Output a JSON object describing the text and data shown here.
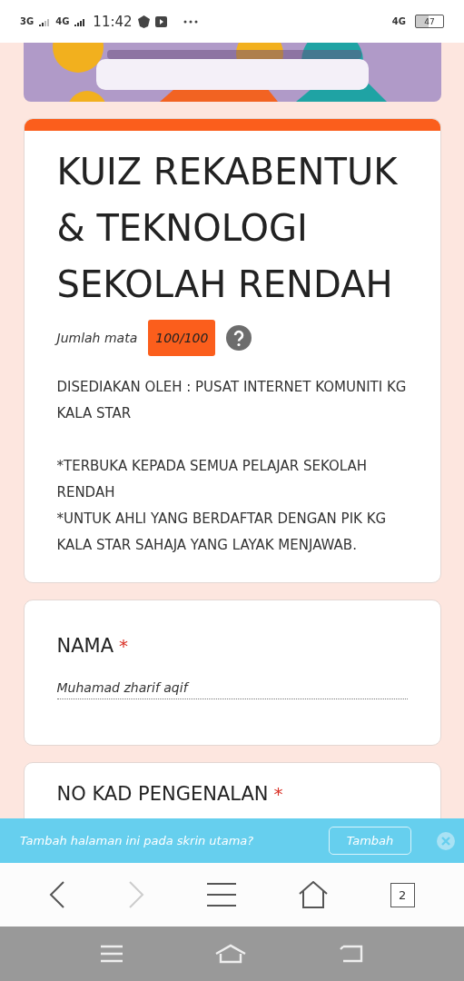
{
  "status_bar": {
    "network_1": "3G",
    "network_2": "4G",
    "time": "11:42",
    "network_right": "4G",
    "battery": "47"
  },
  "intro_card": {
    "title": "KUIZ REKABENTUK & TEKNOLOGI SEKOLAH RENDAH",
    "points_label": "Jumlah mata",
    "points": "100/100",
    "description": [
      [
        "DISEDIAKAN OLEH : PUSAT INTERNET KOMUNITI KG KALA STAR"
      ],
      [
        "*TERBUKA KEPADA SEMUA PELAJAR SEKOLAH RENDAH",
        "*UNTUK AHLI YANG BERDAFTAR DENGAN PIK KG KALA STAR SAHAJA YANG LAYAK MENJAWAB."
      ]
    ]
  },
  "questions": [
    {
      "label": "NAMA",
      "required": true,
      "required_mark": "*",
      "value": "Muhamad zharif aqif"
    },
    {
      "label": "NO KAD PENGENALAN",
      "required": true,
      "required_mark": "*"
    }
  ],
  "add_to_home_banner": {
    "message": "Tambah halaman ini pada skrin utama?",
    "button": "Tambah"
  },
  "browser_toolbar": {
    "back_disabled": false,
    "forward_disabled": true,
    "tabs_count": "2"
  }
}
